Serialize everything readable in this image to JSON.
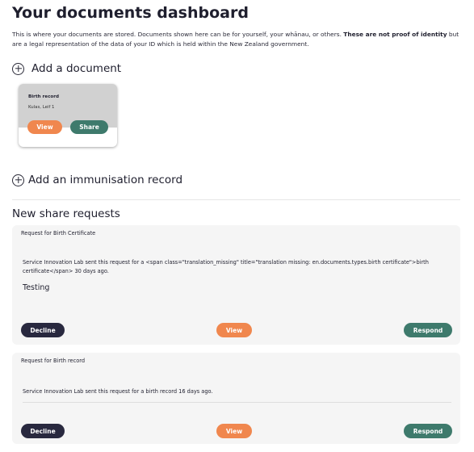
{
  "header": {
    "title": "Your documents dashboard",
    "intro_text": "This is where your documents are stored. Documents shown here can be for yourself, your whānau, or others.",
    "intro_bold": "These are not proof of identity",
    "intro_text_end": "but are a legal representation of the data of your ID which is held within the New Zealand government."
  },
  "add_document": {
    "label": "Add a document",
    "icon": "plus-circle-icon"
  },
  "documents": [
    {
      "title": "Birth record",
      "subtitle": "Kulas, Leif 1",
      "view_label": "View",
      "share_label": "Share"
    }
  ],
  "add_immunisation": {
    "label": "Add an immunisation record",
    "icon": "plus-circle-icon"
  },
  "share_requests": {
    "heading": "New share requests",
    "items": [
      {
        "heading": "Request for Birth Certificate",
        "text": "Service Innovation Lab sent this request for a <span class=\"translation_missing\" title=\"translation missing: en.documents.types.birth certificate\">birth certificate</span> 30 days ago.",
        "note": "Testing",
        "decline_label": "Decline",
        "view_label": "View",
        "respond_label": "Respond"
      },
      {
        "heading": "Request for Birth record",
        "text": "Service Innovation Lab sent this request for a birth record 16 days ago.",
        "decline_label": "Decline",
        "view_label": "View",
        "respond_label": "Respond"
      }
    ]
  },
  "colors": {
    "orange": "#f0874e",
    "green": "#3e7a6c",
    "navy": "#29293f",
    "card_grey": "#d1d1d1",
    "panel_grey": "#f5f5f5"
  }
}
